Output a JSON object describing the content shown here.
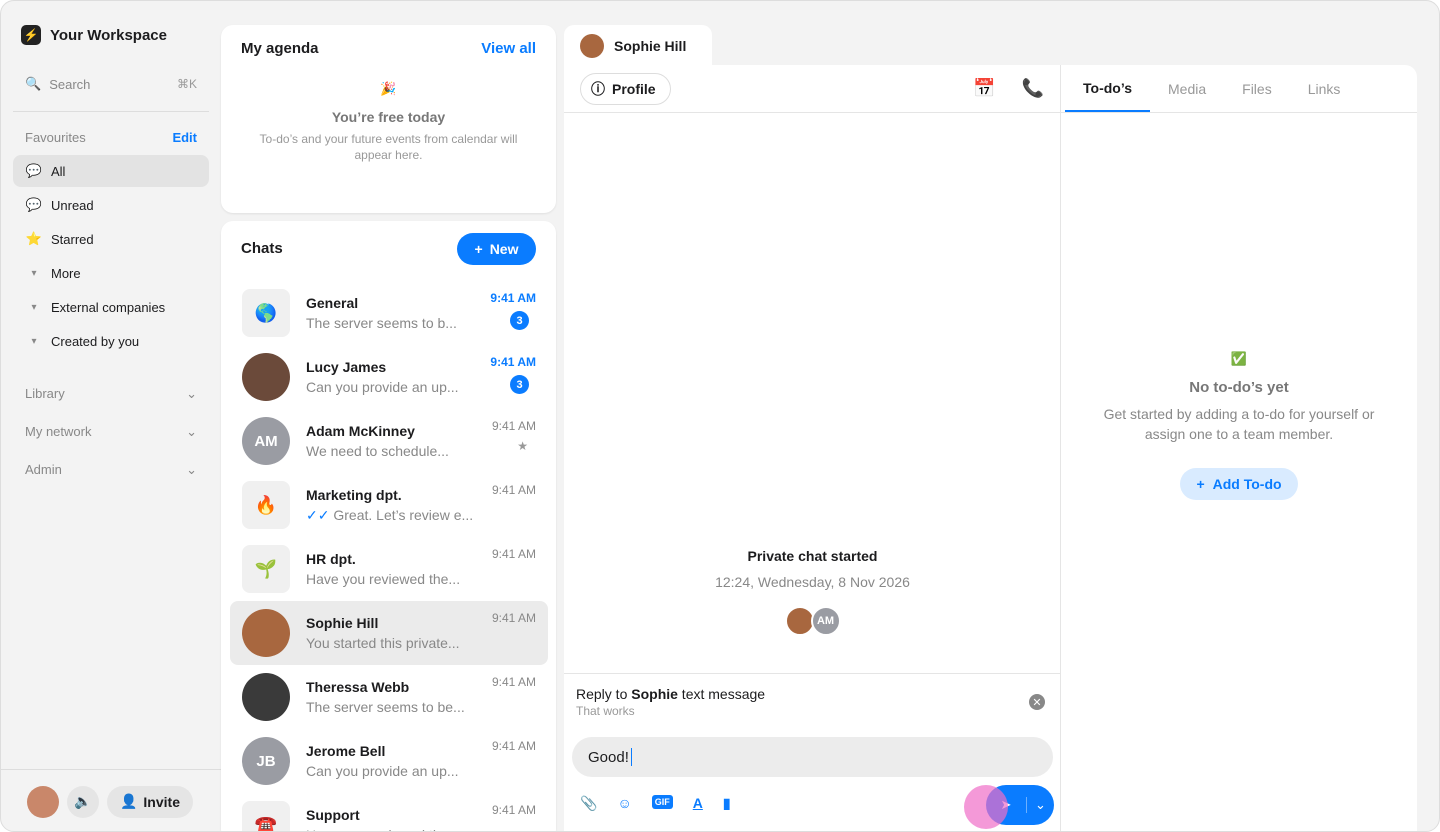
{
  "workspace": {
    "name": "Your Workspace"
  },
  "search": {
    "label": "Search",
    "shortcut": "⌘K"
  },
  "favourites": {
    "label": "Favourites",
    "edit": "Edit",
    "items": [
      {
        "label": "All",
        "icon": "💬"
      },
      {
        "label": "Unread",
        "icon": "💬"
      },
      {
        "label": "Starred",
        "icon": "⭐"
      },
      {
        "label": "More",
        "icon": "▾"
      },
      {
        "label": "External companies",
        "icon": "▾"
      },
      {
        "label": "Created by you",
        "icon": "▾"
      }
    ]
  },
  "sections": [
    "Library",
    "My network",
    "Admin"
  ],
  "footer": {
    "invite": "Invite"
  },
  "agenda": {
    "title": "My agenda",
    "view_all": "View all",
    "empty_title": "You’re free today",
    "empty_text": "To-do’s and your future events from calendar will appear here."
  },
  "chats": {
    "title": "Chats",
    "new_label": "New",
    "items": [
      {
        "name": "General",
        "preview": "The server seems to b...",
        "time": "9:41 AM",
        "unread": "3",
        "avatar": "🌎",
        "type": "square"
      },
      {
        "name": "Lucy James",
        "preview": "Can you provide an up...",
        "time": "9:41 AM",
        "unread": "3",
        "avatar": "",
        "type": "photo",
        "color": "#6b4a3a"
      },
      {
        "name": "Adam McKinney",
        "preview": "We need to schedule...",
        "time": "9:41 AM",
        "starred": true,
        "avatar": "AM",
        "type": "initials"
      },
      {
        "name": "Marketing dpt.",
        "preview": "Great. Let’s review e...",
        "time": "9:41 AM",
        "read": true,
        "avatar": "🔥",
        "type": "square"
      },
      {
        "name": "HR dpt.",
        "preview": "Have you reviewed the...",
        "time": "9:41 AM",
        "avatar": "🌱",
        "type": "square"
      },
      {
        "name": "Sophie Hill",
        "preview": "You started this private...",
        "time": "9:41 AM",
        "avatar": "",
        "type": "photo",
        "color": "#a8673f",
        "selected": true
      },
      {
        "name": "Theressa Webb",
        "preview": "The server seems to be...",
        "time": "9:41 AM",
        "avatar": "",
        "type": "photo",
        "color": "#3a3a3a"
      },
      {
        "name": "Jerome Bell",
        "preview": "Can you provide an up...",
        "time": "9:41 AM",
        "avatar": "JB",
        "type": "initials"
      },
      {
        "name": "Support",
        "preview": "Have you reviewed the...",
        "time": "9:41 AM",
        "avatar": "☎️",
        "type": "square"
      }
    ]
  },
  "conversation": {
    "tab_name": "Sophie Hill",
    "profile": "Profile",
    "started_title": "Private chat started",
    "started_date": "12:24, Wednesday, 8 Nov 2026",
    "participant_initials": "AM",
    "reply_prefix": "Reply to ",
    "reply_name": "Sophie",
    "reply_suffix": " text message",
    "reply_quote": "That works",
    "input_value": "Good!",
    "gif": "GIF"
  },
  "right": {
    "tabs": [
      "To-do’s",
      "Media",
      "Files",
      "Links"
    ],
    "empty_title": "No to-do’s yet",
    "empty_text": "Get started by adding a to-do for yourself or assign one to a team member.",
    "add": "Add To-do"
  },
  "colors": {
    "accent": "#0a7cff"
  }
}
